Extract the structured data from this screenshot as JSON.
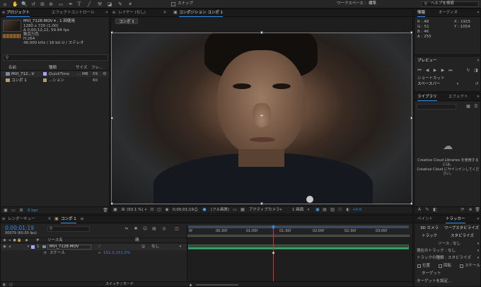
{
  "toolbar": {
    "snap_label": "スナップ",
    "workspace_label": "ワークスペース :",
    "workspace_value": "標準",
    "help_search": "ヘルプを検索"
  },
  "project": {
    "tabs": [
      "プロジェクト",
      "エフェクトコントロール"
    ],
    "file_name": "MVI_7128.MOV ▾ , 1 回使用",
    "file_info": [
      "1280 x 720 (1.00)",
      "Δ 0;00;12;22, 59.94 fps",
      "数百万色",
      "H.264",
      "48.000 kHz / 16 bit U / ステレオ"
    ],
    "search_placeholder": "",
    "columns": [
      "名前",
      "種類",
      "サイズ",
      "フレ..."
    ],
    "rows": [
      {
        "name": "MVI_712...V",
        "type": "QuickTime",
        "size": "... MB",
        "fps": "59"
      },
      {
        "name": "コンポ 1",
        "type": "...ション",
        "size": "",
        "fps": "60"
      }
    ],
    "bpc": "8 bpc"
  },
  "viewer": {
    "tabs": [
      "レイヤー (なし)",
      "コンポジション コンポ 1"
    ],
    "comp_button": "コンポ 1",
    "zoom": "(93.1 %)",
    "timecode": "0;00;01;19",
    "resolution": "(フル画質)",
    "camera": "アクティブカメラ",
    "views": "1 画面",
    "exposure": "+0.0"
  },
  "info": {
    "tabs": [
      "情報",
      "オーディオ"
    ],
    "r": "R : 48",
    "g": "G : 51",
    "b": "B : 46",
    "a": "A : 255",
    "x": "X : 1915",
    "y": "Y : 1054"
  },
  "preview": {
    "title": "プレビュー",
    "shortcut_label": "ショートカット",
    "shortcut_value": "スペースバー"
  },
  "library": {
    "tabs": [
      "ライブラリ",
      "エフェクト"
    ],
    "message_1": "Creative Cloud Libraries を使用するには、",
    "message_2": "Creative Cloud にサインインしてください。"
  },
  "tracker": {
    "tabs": [
      "ペイント",
      "トラッカー"
    ],
    "buttons": [
      "3D カメラ",
      "ワープスタビライズ",
      "トラック",
      "スタビライズ"
    ],
    "source_label": "ソース :",
    "source_value": "なし",
    "current_track": "現在のトラック :",
    "current_track_value": "なし",
    "track_type": "トラックの種類 :",
    "track_type_value": "スタビライズ",
    "checkboxes": [
      "位置",
      "回転",
      "スケール"
    ],
    "target": "ターゲット",
    "target_set": "ターゲットを設定..."
  },
  "timeline": {
    "tabs": [
      "レンダーキュー",
      "コンポ 1"
    ],
    "timecode": "0;00;01;19",
    "frame": "00079 (60.00 fps)",
    "col_source": "ソース名",
    "col_parent": "親",
    "layer_num": "1",
    "layer_name": "MVI_7128.MOV",
    "parent_value": "なし",
    "property": "スケール",
    "scale_value": "151.0,151.0%",
    "ruler": [
      "0f",
      "00:30f",
      "01:00f",
      "01:30f",
      "02:00f",
      "02:30f",
      "03:00f"
    ],
    "switch_mode": "スイッチ / モード"
  },
  "colors": {
    "accent": "#2d8ceb",
    "bg": "#232323",
    "track_green": "#39a86b",
    "playhead": "#d93030"
  }
}
